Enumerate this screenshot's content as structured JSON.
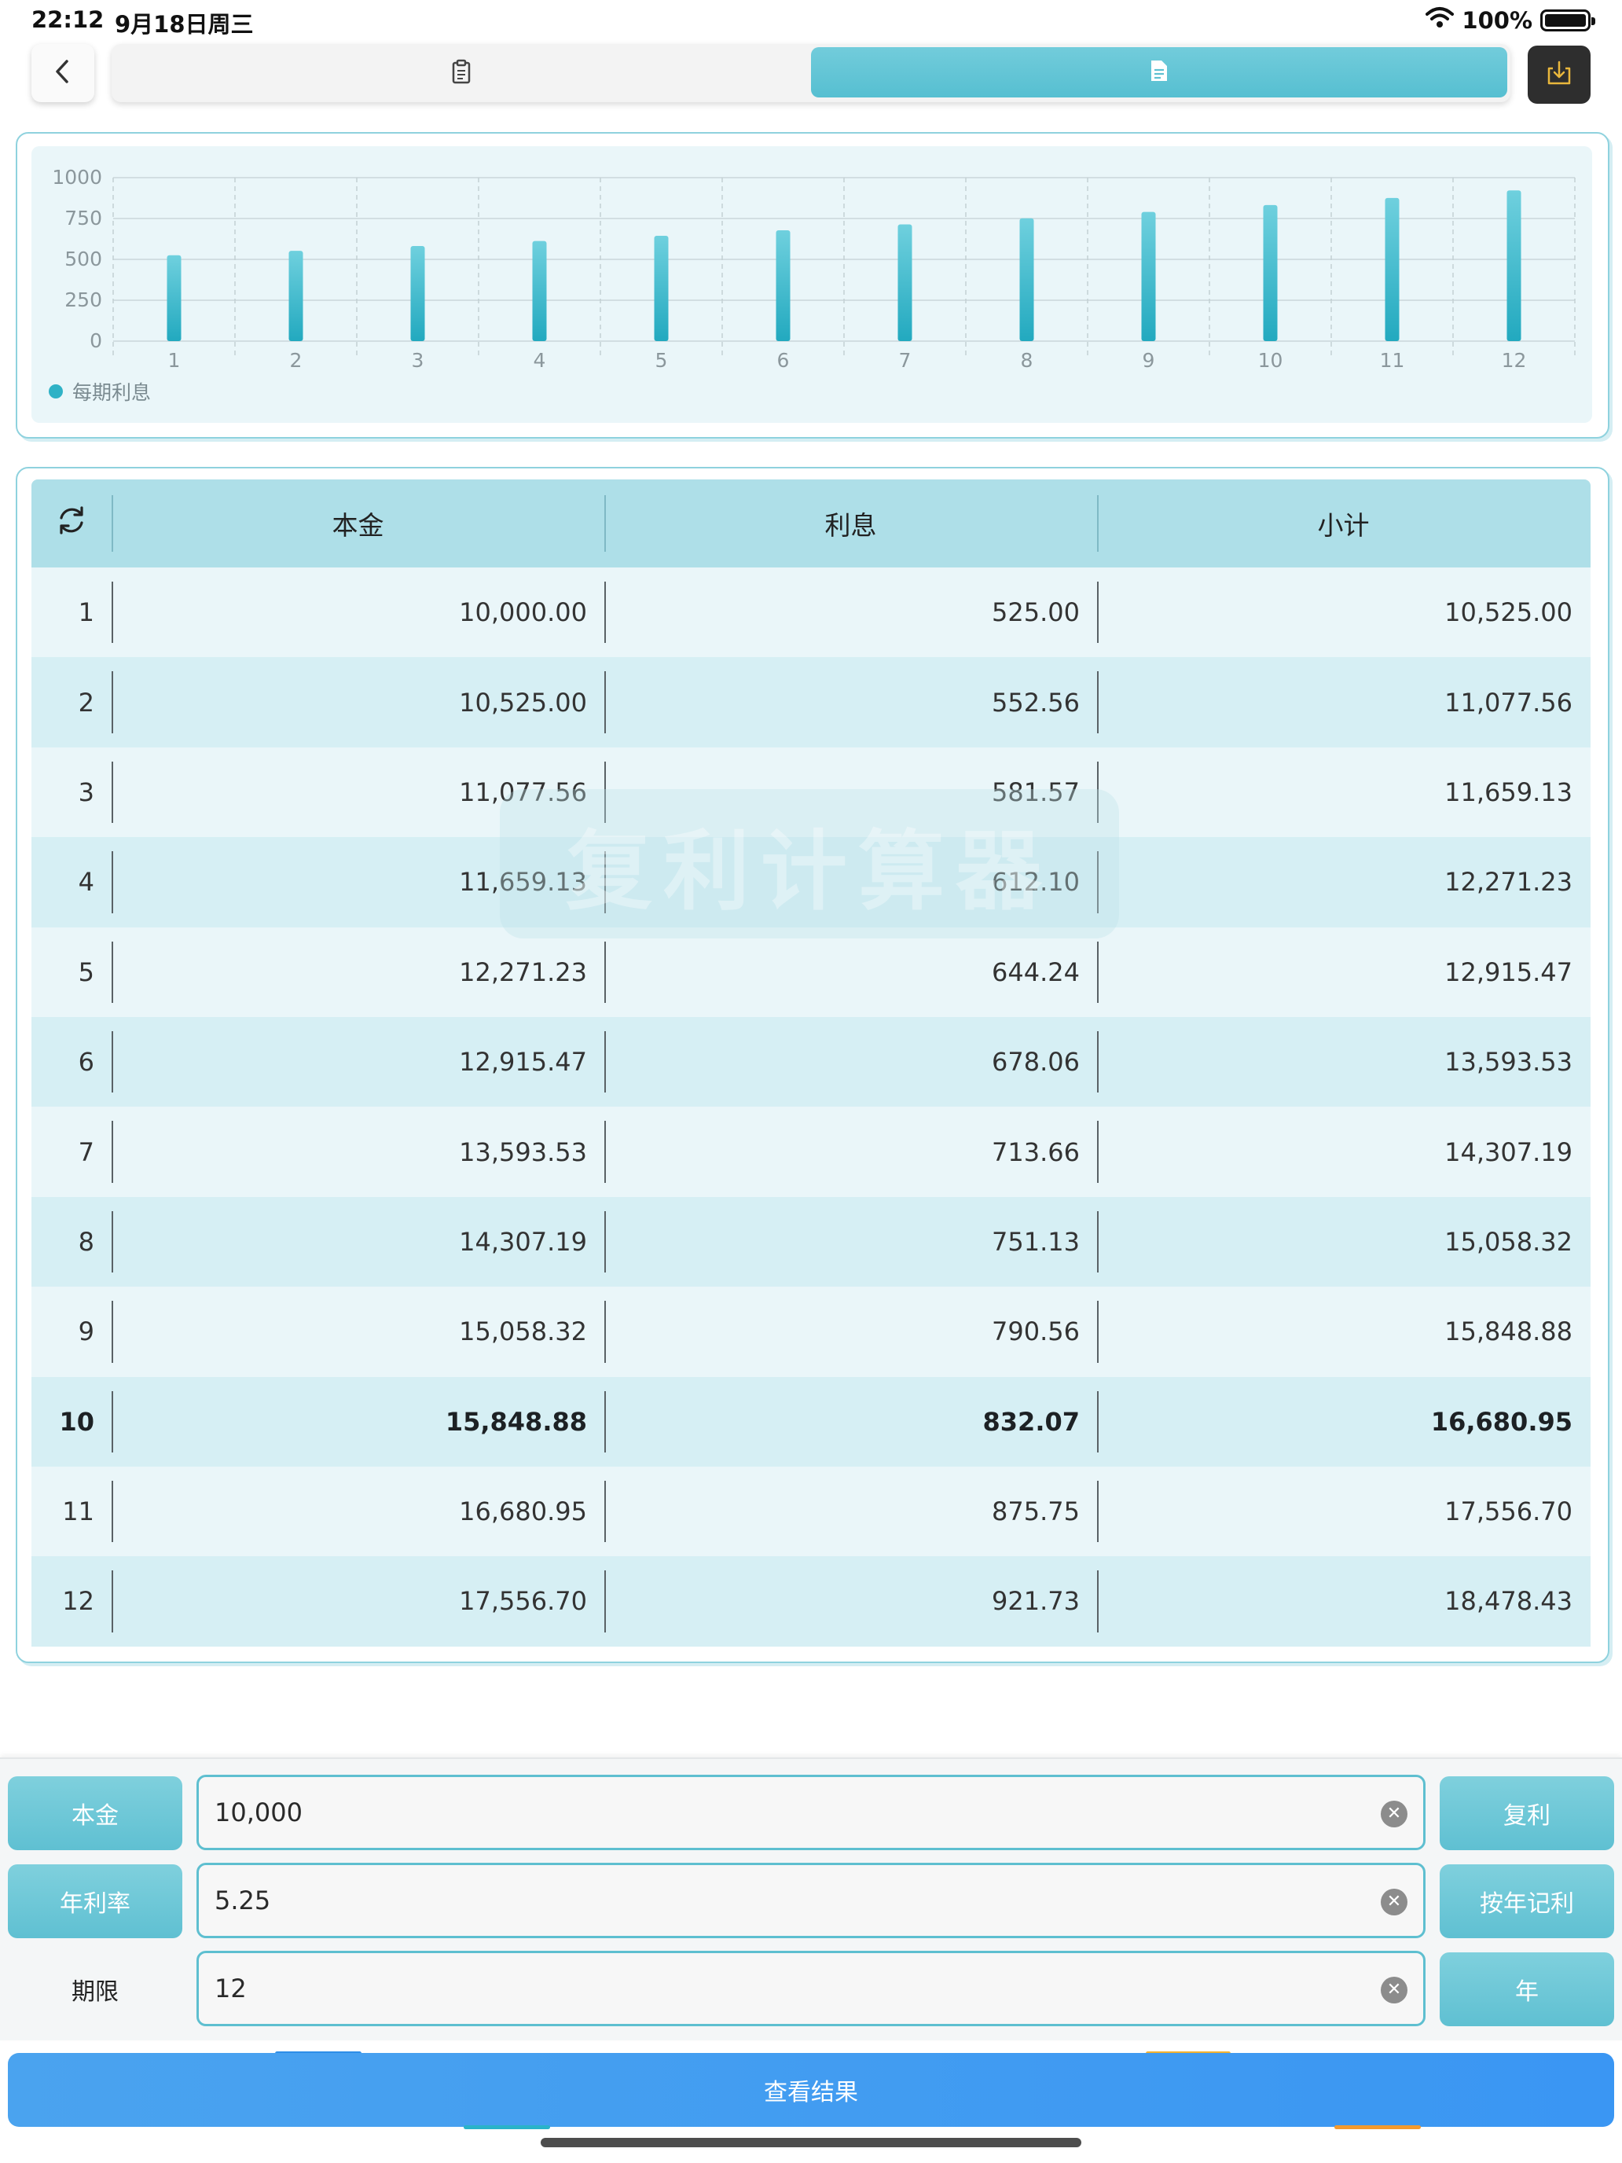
{
  "status_bar": {
    "time": "22:12",
    "date": "9月18日周三",
    "battery": "100%",
    "battery_level": 1.0
  },
  "nav": {
    "back_icon": "chevron-left-icon",
    "tab_list_icon": "clipboard-icon",
    "tab_detail_icon": "document-icon",
    "export_icon": "download-tray-icon",
    "active_tab": "detail"
  },
  "chart_data": {
    "type": "bar",
    "categories": [
      "1",
      "2",
      "3",
      "4",
      "5",
      "6",
      "7",
      "8",
      "9",
      "10",
      "11",
      "12"
    ],
    "series": [
      {
        "name": "每期利息",
        "values": [
          525.0,
          552.56,
          581.57,
          612.1,
          644.24,
          678.06,
          713.66,
          751.13,
          790.56,
          832.07,
          875.75,
          921.73
        ]
      }
    ],
    "yticks": [
      "0",
      "250",
      "500",
      "750",
      "1000"
    ],
    "ylim": [
      0,
      1000
    ],
    "grid": true,
    "legend_position": "bottom-left",
    "bar_color": "#2fb2c6"
  },
  "table": {
    "headers": [
      "本金",
      "利息",
      "小计"
    ],
    "refresh_icon": "refresh-icon",
    "rows": [
      {
        "n": "1",
        "principal": "10,000.00",
        "interest": "525.00",
        "subtotal": "10,525.00"
      },
      {
        "n": "2",
        "principal": "10,525.00",
        "interest": "552.56",
        "subtotal": "11,077.56"
      },
      {
        "n": "3",
        "principal": "11,077.56",
        "interest": "581.57",
        "subtotal": "11,659.13"
      },
      {
        "n": "4",
        "principal": "11,659.13",
        "interest": "612.10",
        "subtotal": "12,271.23"
      },
      {
        "n": "5",
        "principal": "12,271.23",
        "interest": "644.24",
        "subtotal": "12,915.47"
      },
      {
        "n": "6",
        "principal": "12,915.47",
        "interest": "678.06",
        "subtotal": "13,593.53"
      },
      {
        "n": "7",
        "principal": "13,593.53",
        "interest": "713.66",
        "subtotal": "14,307.19"
      },
      {
        "n": "8",
        "principal": "14,307.19",
        "interest": "751.13",
        "subtotal": "15,058.32"
      },
      {
        "n": "9",
        "principal": "15,058.32",
        "interest": "790.56",
        "subtotal": "15,848.88"
      },
      {
        "n": "10",
        "principal": "15,848.88",
        "interest": "832.07",
        "subtotal": "16,680.95"
      },
      {
        "n": "11",
        "principal": "16,680.95",
        "interest": "875.75",
        "subtotal": "17,556.70"
      },
      {
        "n": "12",
        "principal": "17,556.70",
        "interest": "921.73",
        "subtotal": "18,478.43"
      }
    ],
    "bold_row": "10"
  },
  "watermark": "复利计算器",
  "form": {
    "principal_label": "本金",
    "principal_value": "10,000",
    "rate_label": "年利率",
    "rate_value": "5.25",
    "term_label": "期限",
    "term_value": "12",
    "mode_label": "复利",
    "compound_label": "按年记利",
    "unit_label": "年",
    "clear_icon": "clear-icon",
    "submit_label": "查看结果"
  },
  "colors": {
    "accent": "#5fc0d2",
    "header_bg": "#aedfe8",
    "submit_bg": "#3a96f3"
  }
}
